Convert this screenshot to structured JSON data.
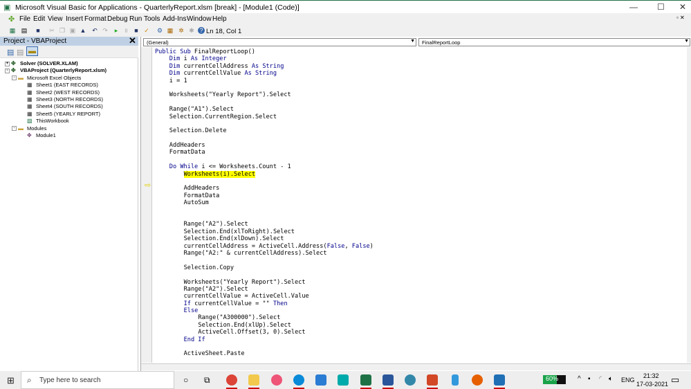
{
  "window": {
    "title": "Microsoft Visual Basic for Applications - QuarterlyReport.xlsm [break] - [Module1 (Code)]",
    "controls": [
      "—",
      "☐",
      "✕"
    ]
  },
  "menu": [
    "File",
    "Edit",
    "View",
    "Insert",
    "Format",
    "Debug",
    "Run",
    "Tools",
    "Add-Ins",
    "Window",
    "Help"
  ],
  "toolbar": {
    "status": "Ln 18, Col 1"
  },
  "project": {
    "title": "Project - VBAProject",
    "tree": [
      {
        "label": "Solver (SOLVER.XLAM)",
        "level": 0,
        "bold": true,
        "icon": "vba-project-icon",
        "toggle": "+"
      },
      {
        "label": "VBAProject (QuarterlyReport.xlsm)",
        "level": 0,
        "bold": true,
        "icon": "vba-project-icon",
        "toggle": "-"
      },
      {
        "label": "Microsoft Excel Objects",
        "level": 1,
        "icon": "folder-icon",
        "toggle": "-"
      },
      {
        "label": "Sheet1 (EAST RECORDS)",
        "level": 2,
        "icon": "sheet-icon"
      },
      {
        "label": "Sheet2 (WEST RECORDS)",
        "level": 2,
        "icon": "sheet-icon"
      },
      {
        "label": "Sheet3 (NORTH RECORDS)",
        "level": 2,
        "icon": "sheet-icon"
      },
      {
        "label": "Sheet4 (SOUTH RECORDS)",
        "level": 2,
        "icon": "sheet-icon"
      },
      {
        "label": "Sheet5 (YEARLY REPORT)",
        "level": 2,
        "icon": "sheet-icon"
      },
      {
        "label": "ThisWorkbook",
        "level": 2,
        "icon": "workbook-icon"
      },
      {
        "label": "Modules",
        "level": 1,
        "icon": "folder-icon",
        "toggle": "-"
      },
      {
        "label": "Module1",
        "level": 2,
        "icon": "module-icon"
      }
    ]
  },
  "code": {
    "object_dropdown": "(General)",
    "proc_dropdown": "FinalReportLoop",
    "current_line": 17,
    "lines": [
      [
        0,
        [
          [
            "Public Sub ",
            1
          ],
          [
            "FinalReportLoop()",
            0
          ]
        ]
      ],
      [
        1,
        [
          [
            "Dim ",
            1
          ],
          [
            "i ",
            0
          ],
          [
            "As Integer",
            1
          ]
        ]
      ],
      [
        1,
        [
          [
            "Dim ",
            1
          ],
          [
            "currentCellAddress ",
            0
          ],
          [
            "As String",
            1
          ]
        ]
      ],
      [
        1,
        [
          [
            "Dim ",
            1
          ],
          [
            "currentCellValue ",
            0
          ],
          [
            "As String",
            1
          ]
        ]
      ],
      [
        1,
        [
          [
            "i = 1",
            0
          ]
        ]
      ],
      [
        0,
        []
      ],
      [
        1,
        [
          [
            "Worksheets(\"Yearly Report\").Select",
            0
          ]
        ]
      ],
      [
        0,
        []
      ],
      [
        1,
        [
          [
            "Range(\"A1\").Select",
            0
          ]
        ]
      ],
      [
        1,
        [
          [
            "Selection.CurrentRegion.Select",
            0
          ]
        ]
      ],
      [
        0,
        []
      ],
      [
        1,
        [
          [
            "Selection.Delete",
            0
          ]
        ]
      ],
      [
        0,
        []
      ],
      [
        1,
        [
          [
            "AddHeaders",
            0
          ]
        ]
      ],
      [
        1,
        [
          [
            "FormatData",
            0
          ]
        ]
      ],
      [
        0,
        []
      ],
      [
        1,
        [
          [
            "Do While ",
            1
          ],
          [
            "i <= Worksheets.Count - 1",
            0
          ]
        ]
      ],
      [
        2,
        [
          [
            "Worksheets(i).Select",
            0
          ]
        ]
      ],
      [
        0,
        []
      ],
      [
        2,
        [
          [
            "AddHeaders",
            0
          ]
        ]
      ],
      [
        2,
        [
          [
            "FormatData",
            0
          ]
        ]
      ],
      [
        2,
        [
          [
            "AutoSum",
            0
          ]
        ]
      ],
      [
        0,
        []
      ],
      [
        0,
        []
      ],
      [
        2,
        [
          [
            "Range(\"A2\").Select",
            0
          ]
        ]
      ],
      [
        2,
        [
          [
            "Selection.End(xlToRight).Select",
            0
          ]
        ]
      ],
      [
        2,
        [
          [
            "Selection.End(xlDown).Select",
            0
          ]
        ]
      ],
      [
        2,
        [
          [
            "currentCellAddress = ActiveCell.Address(",
            0
          ],
          [
            "False",
            1
          ],
          [
            ", ",
            0
          ],
          [
            "False",
            1
          ],
          [
            ")",
            0
          ]
        ]
      ],
      [
        2,
        [
          [
            "Range(\"A2:\" & currentCellAddress).Select",
            0
          ]
        ]
      ],
      [
        0,
        []
      ],
      [
        2,
        [
          [
            "Selection.Copy",
            0
          ]
        ]
      ],
      [
        0,
        []
      ],
      [
        2,
        [
          [
            "Worksheets(\"Yearly Report\").Select",
            0
          ]
        ]
      ],
      [
        2,
        [
          [
            "Range(\"A2\").Select",
            0
          ]
        ]
      ],
      [
        2,
        [
          [
            "currentCellValue = ActiveCell.Value",
            0
          ]
        ]
      ],
      [
        2,
        [
          [
            "If ",
            1
          ],
          [
            "currentCellValue = \"\" ",
            0
          ],
          [
            "Then",
            1
          ]
        ]
      ],
      [
        2,
        [
          [
            "Else",
            1
          ]
        ]
      ],
      [
        3,
        [
          [
            "Range(\"A300000\").Select",
            0
          ]
        ]
      ],
      [
        3,
        [
          [
            "Selection.End(xlUp).Select",
            0
          ]
        ]
      ],
      [
        3,
        [
          [
            "ActiveCell.Offset(3, 0).Select",
            0
          ]
        ]
      ],
      [
        2,
        [
          [
            "End If",
            1
          ]
        ]
      ],
      [
        0,
        []
      ],
      [
        2,
        [
          [
            "ActiveSheet.Paste",
            0
          ]
        ]
      ]
    ]
  },
  "taskbar": {
    "search_placeholder": "Type here to search",
    "battery": "60%",
    "battery_level": 0.6,
    "lang": "ENG",
    "time": "21:32",
    "date": "17-03-2021"
  },
  "colors": {
    "keyword": "#00008b",
    "highlight": "#ffff00",
    "excel_green": "#1e7145"
  }
}
